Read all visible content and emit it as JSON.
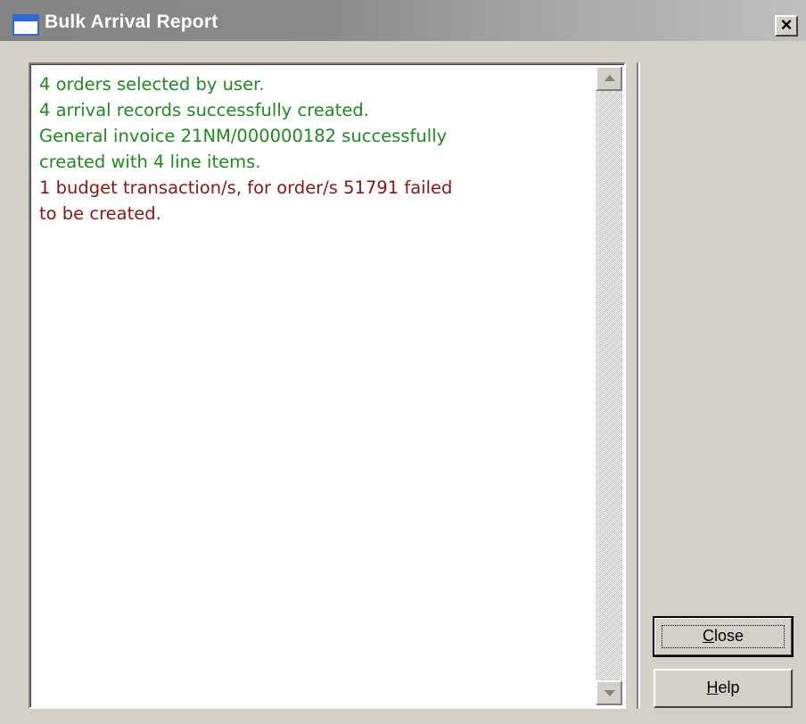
{
  "window": {
    "title": "Bulk Arrival Report",
    "title_icon": "window-icon",
    "close_glyph": "×"
  },
  "report": {
    "lines": [
      {
        "text": "4 orders selected by user.",
        "status": "success"
      },
      {
        "text": "4 arrival records successfully created.",
        "status": "success"
      },
      {
        "text": "General invoice 21NM/000000182 successfully",
        "status": "success"
      },
      {
        "text": "created with 4 line items.",
        "status": "success"
      },
      {
        "text": "1 budget transaction/s, for order/s 51791 failed",
        "status": "error"
      },
      {
        "text": "to be created.",
        "status": "error"
      }
    ],
    "success_color": "#1f8a1f",
    "error_color": "#8b1515"
  },
  "buttons": {
    "close": {
      "mnemonic": "C",
      "rest": "lose"
    },
    "help": {
      "mnemonic": "H",
      "rest": "elp"
    }
  }
}
